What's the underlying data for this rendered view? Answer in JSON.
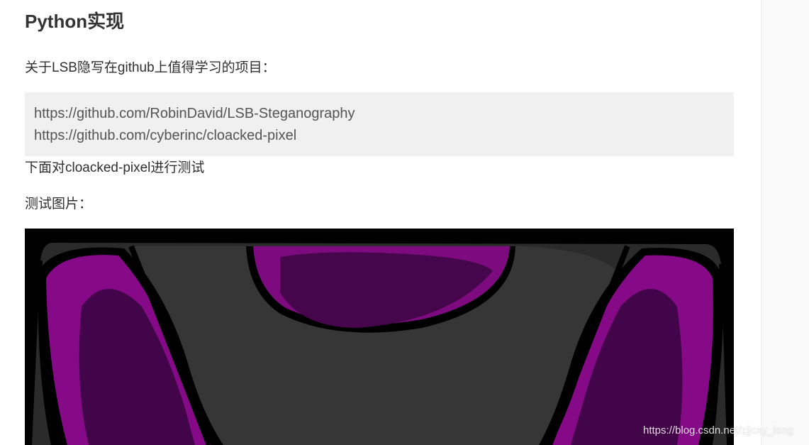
{
  "article": {
    "section_title": "Python实现",
    "intro": "关于LSB隐写在github上值得学习的项目：",
    "links": [
      "https://github.com/RobinDavid/LSB-Steganography",
      "https://github.com/cyberinc/cloacked-pixel"
    ],
    "test_line": "下面对cloacked-pixel进行测试",
    "image_label": "测试图片："
  },
  "image": {
    "watermark": "https://blog.csdn.net/zjjcxy_long",
    "colors": {
      "outline": "#000000",
      "dark_gray": "#2a2a2a",
      "mid_gray": "#3a3a3a",
      "purple": "#8a0a8c",
      "deep_purple": "#4a0550"
    }
  }
}
